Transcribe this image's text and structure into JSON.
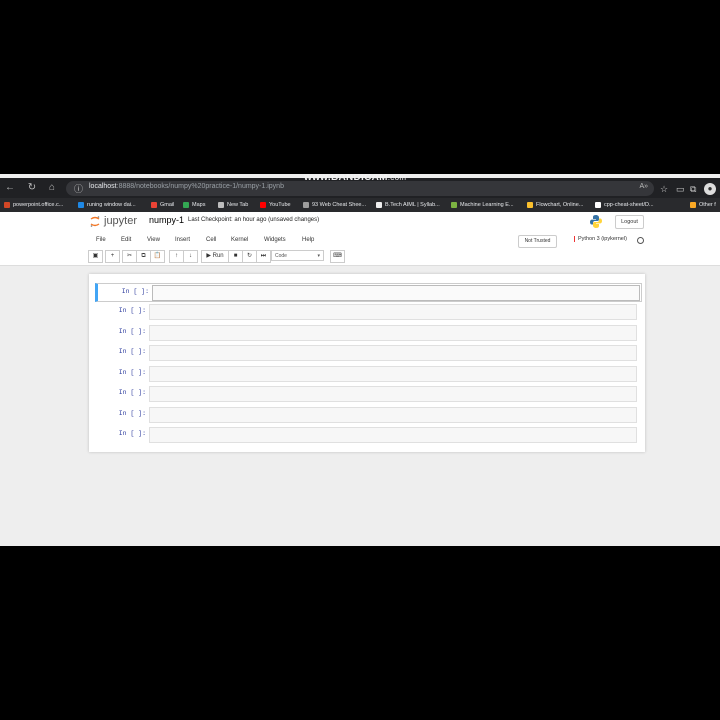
{
  "browser": {
    "url_host": "localhost",
    "url_path": ":8888/notebooks/numpy%20practice-1/numpy-1.ipynb",
    "watermark_main": "www.BANDICAM",
    "watermark_suffix": ".com",
    "reader_mode": "A»",
    "profile_initial": "●",
    "bookmarks": [
      {
        "label": "powerpoint.office.c...",
        "color": "#d24726"
      },
      {
        "label": "runing window dai...",
        "color": "#1e88e5"
      },
      {
        "label": "Gmail",
        "color": "#ea4335"
      },
      {
        "label": "Maps",
        "color": "#34a853"
      },
      {
        "label": "New Tab",
        "color": "#bdbdbd"
      },
      {
        "label": "YouTube",
        "color": "#ff0000"
      },
      {
        "label": "93 Web Cheat Shee...",
        "color": "#9e9e9e"
      },
      {
        "label": "B.Tech AIML | Syllab...",
        "color": "#eeeeee"
      },
      {
        "label": "Machine Learning E...",
        "color": "#7cb342"
      },
      {
        "label": "Flowchart, Online...",
        "color": "#fbc02d"
      },
      {
        "label": "cpp-cheat-sheet/D...",
        "color": "#ffffff"
      },
      {
        "label": "Other f",
        "color": "#f9a825"
      }
    ]
  },
  "jupyter": {
    "logo_text": "jupyter",
    "notebook_name": "numpy-1",
    "checkpoint_label": "Last Checkpoint:",
    "checkpoint_time": "an hour ago",
    "save_status": "(unsaved changes)",
    "logout_label": "Logout",
    "menus": [
      "File",
      "Edit",
      "View",
      "Insert",
      "Cell",
      "Kernel",
      "Widgets",
      "Help"
    ],
    "trust_label": "Not Trusted",
    "kernel_label": "Python 3 (ipykernel)",
    "run_label": "Run",
    "cell_type": "Code",
    "cells": [
      {
        "prompt": "In [ ]:"
      },
      {
        "prompt": "In [ ]:"
      },
      {
        "prompt": "In [ ]:"
      },
      {
        "prompt": "In [ ]:"
      },
      {
        "prompt": "In [ ]:"
      },
      {
        "prompt": "In [ ]:"
      },
      {
        "prompt": "In [ ]:"
      },
      {
        "prompt": "In [ ]:"
      }
    ]
  }
}
